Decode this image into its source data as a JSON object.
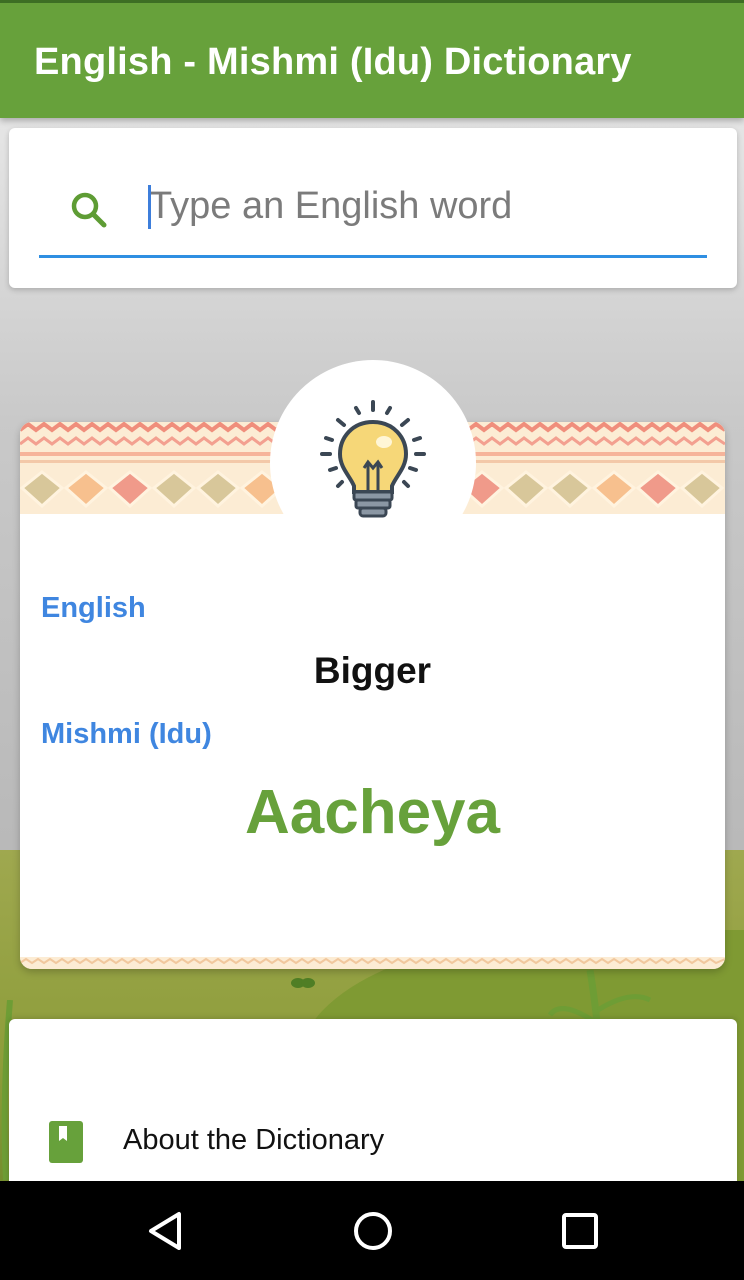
{
  "app": {
    "title": "English - Mishmi (Idu) Dictionary",
    "accent_color": "#67a13b",
    "label_color": "#3f86e0"
  },
  "search": {
    "icon": "search-icon",
    "placeholder": "Type an English word",
    "value": ""
  },
  "word_card": {
    "icon": "lightbulb-icon",
    "english_label": "English",
    "english_word": "Bigger",
    "mishmi_label": "Mishmi (Idu)",
    "mishmi_word": "Aacheya"
  },
  "menu": {
    "items": [
      {
        "icon": "book-icon",
        "label": "About the Dictionary"
      }
    ]
  },
  "navbar": {
    "buttons": [
      "back-icon",
      "home-icon",
      "recents-icon"
    ]
  }
}
